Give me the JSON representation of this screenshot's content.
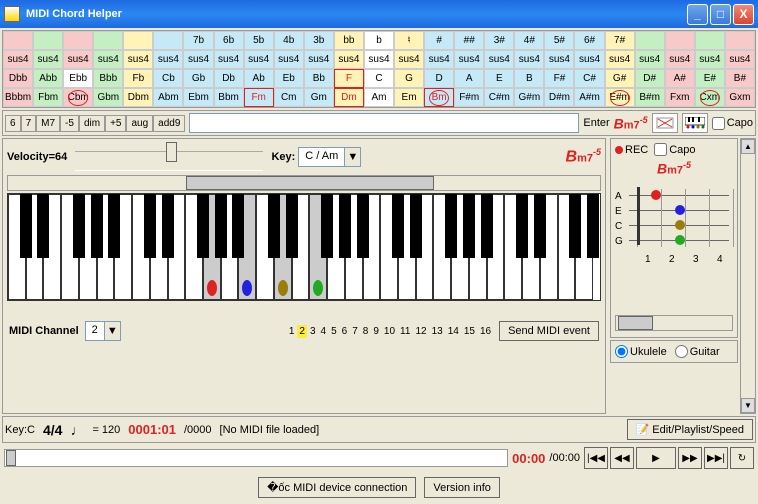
{
  "title": "MIDI Chord Helper",
  "grid": {
    "row1": [
      "",
      "",
      "",
      "",
      "",
      "",
      "7b",
      "6b",
      "5b",
      "4b",
      "3b",
      "bb",
      "b",
      "♮",
      "#",
      "##",
      "3#",
      "4#",
      "5#",
      "6#",
      "7#",
      "",
      "",
      "",
      ""
    ],
    "row2_label": "sus4",
    "row3": [
      "Dbb",
      "Abb",
      "Ebb",
      "Bbb",
      "Fb",
      "Cb",
      "Gb",
      "Db",
      "Ab",
      "Eb",
      "Bb",
      "F",
      "C",
      "G",
      "D",
      "A",
      "E",
      "B",
      "F#",
      "C#",
      "G#",
      "D#",
      "A#",
      "E#",
      "B#"
    ],
    "row4": [
      "Bbbm",
      "Fbm",
      "Cbm",
      "Gbm",
      "Dbm",
      "Abm",
      "Ebm",
      "Bbm",
      "Fm",
      "Cm",
      "Gm",
      "Dm",
      "Am",
      "Em",
      "Bm",
      "F#m",
      "C#m",
      "G#m",
      "D#m",
      "A#m",
      "E#m",
      "B#m",
      "Fxm",
      "Cxm",
      "Gxm"
    ]
  },
  "modifiers": [
    "6",
    "7",
    "M7",
    "-5",
    "dim",
    "+5",
    "aug",
    "add9"
  ],
  "enter_label": "Enter",
  "current_chord_html": "Bm7<sup>-5</sup>",
  "capo_label": "Capo",
  "velocity_label": "Velocity=64",
  "key_label": "Key:",
  "key_value": "C / Am",
  "display_chord": "Bm7",
  "display_chord_sup": "-5",
  "midi_channel_label": "MIDI Channel",
  "midi_channel_value": "2",
  "channels": [
    "1",
    "2",
    "3",
    "4",
    "5",
    "6",
    "7",
    "8",
    "9",
    "10",
    "11",
    "12",
    "13",
    "14",
    "15",
    "16"
  ],
  "send_midi_label": "Send MIDI event",
  "rec_label": "REC",
  "fret_strings": [
    "A",
    "E",
    "C",
    "G"
  ],
  "fret_nums": [
    "1",
    "2",
    "3",
    "4"
  ],
  "instrument_ukulele": "Ukulele",
  "instrument_guitar": "Guitar",
  "playback": {
    "key_label": "Key:C",
    "timesig": "4/4",
    "tempo_note": "♩",
    "tempo_eq": "= 120",
    "position": "0001:01",
    "total": "/0000",
    "status": "[No MIDI file loaded]",
    "edit_btn": "Edit/Playlist/Speed",
    "time_current": "00:00",
    "time_total": "/00:00"
  },
  "footer": {
    "device_btn": "MIDI device connection",
    "version_btn": "Version info"
  },
  "chart_data": {
    "type": "table",
    "title": "Chord grid and piano chord display",
    "chord": "Bm7-5",
    "pressed_note_colors": [
      "red",
      "blue",
      "olive",
      "green"
    ],
    "fretboard": {
      "tuning": [
        "A",
        "E",
        "C",
        "G"
      ],
      "dots": [
        {
          "string": "A",
          "fret": 1,
          "color": "red"
        },
        {
          "string": "E",
          "fret": 2,
          "color": "blue"
        },
        {
          "string": "C",
          "fret": 2,
          "color": "olive"
        },
        {
          "string": "G",
          "fret": 2,
          "color": "green"
        }
      ]
    }
  }
}
